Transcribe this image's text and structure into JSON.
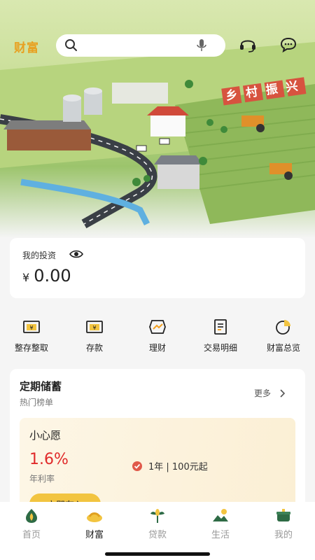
{
  "header": {
    "title": "财富",
    "search_placeholder": "",
    "icons": [
      "search-icon",
      "microphone-icon",
      "headset-icon",
      "chat-icon"
    ]
  },
  "banner": {
    "sign_text": "乡村振兴"
  },
  "investment": {
    "label": "我的投资",
    "currency": "¥",
    "amount": "0.00"
  },
  "quick_menu": [
    {
      "label": "整存整取",
      "icon": "passbook-icon"
    },
    {
      "label": "存款",
      "icon": "deposit-icon"
    },
    {
      "label": "理财",
      "icon": "wealth-management-icon"
    },
    {
      "label": "交易明细",
      "icon": "transaction-detail-icon"
    },
    {
      "label": "财富总览",
      "icon": "pie-chart-icon"
    }
  ],
  "savings": {
    "title": "定期储蓄",
    "subtitle": "热门榜单",
    "more_label": "更多",
    "product": {
      "name": "小心愿",
      "rate": "1.6%",
      "rate_label": "年利率",
      "term": "1年 | 100元起",
      "button_label": "立即存入"
    }
  },
  "bottom_nav": [
    {
      "label": "首页",
      "icon": "home-icon",
      "active": false
    },
    {
      "label": "财富",
      "icon": "wealth-icon",
      "active": true
    },
    {
      "label": "贷款",
      "icon": "loan-icon",
      "active": false
    },
    {
      "label": "生活",
      "icon": "life-icon",
      "active": false
    },
    {
      "label": "我的",
      "icon": "mine-icon",
      "active": false
    }
  ],
  "colors": {
    "accent_yellow": "#f2c440",
    "title_orange": "#e8a020",
    "rate_red": "#e02a2a",
    "nav_inactive": "#999999"
  }
}
